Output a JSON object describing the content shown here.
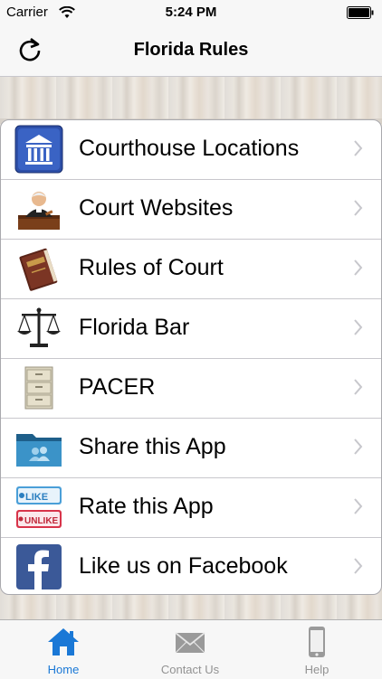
{
  "status_bar": {
    "carrier": "Carrier",
    "time": "5:24 PM"
  },
  "navbar": {
    "title": "Florida Rules",
    "refresh_icon": "refresh-icon"
  },
  "menu": {
    "items": [
      {
        "label": "Courthouse Locations",
        "icon": "courthouse-icon"
      },
      {
        "label": "Court Websites",
        "icon": "judge-icon"
      },
      {
        "label": "Rules of Court",
        "icon": "law-book-icon"
      },
      {
        "label": "Florida Bar",
        "icon": "scales-icon"
      },
      {
        "label": "PACER",
        "icon": "file-cabinet-icon"
      },
      {
        "label": "Share this App",
        "icon": "share-folder-icon"
      },
      {
        "label": "Rate this App",
        "icon": "like-unlike-icon"
      },
      {
        "label": "Like us on Facebook",
        "icon": "facebook-icon"
      }
    ]
  },
  "tabs": [
    {
      "label": "Home",
      "icon": "home-icon",
      "active": true
    },
    {
      "label": "Contact Us",
      "icon": "envelope-icon",
      "active": false
    },
    {
      "label": "Help",
      "icon": "phone-icon",
      "active": false
    }
  ],
  "colors": {
    "accent": "#1a78d6",
    "separator": "#c8c7cc"
  }
}
